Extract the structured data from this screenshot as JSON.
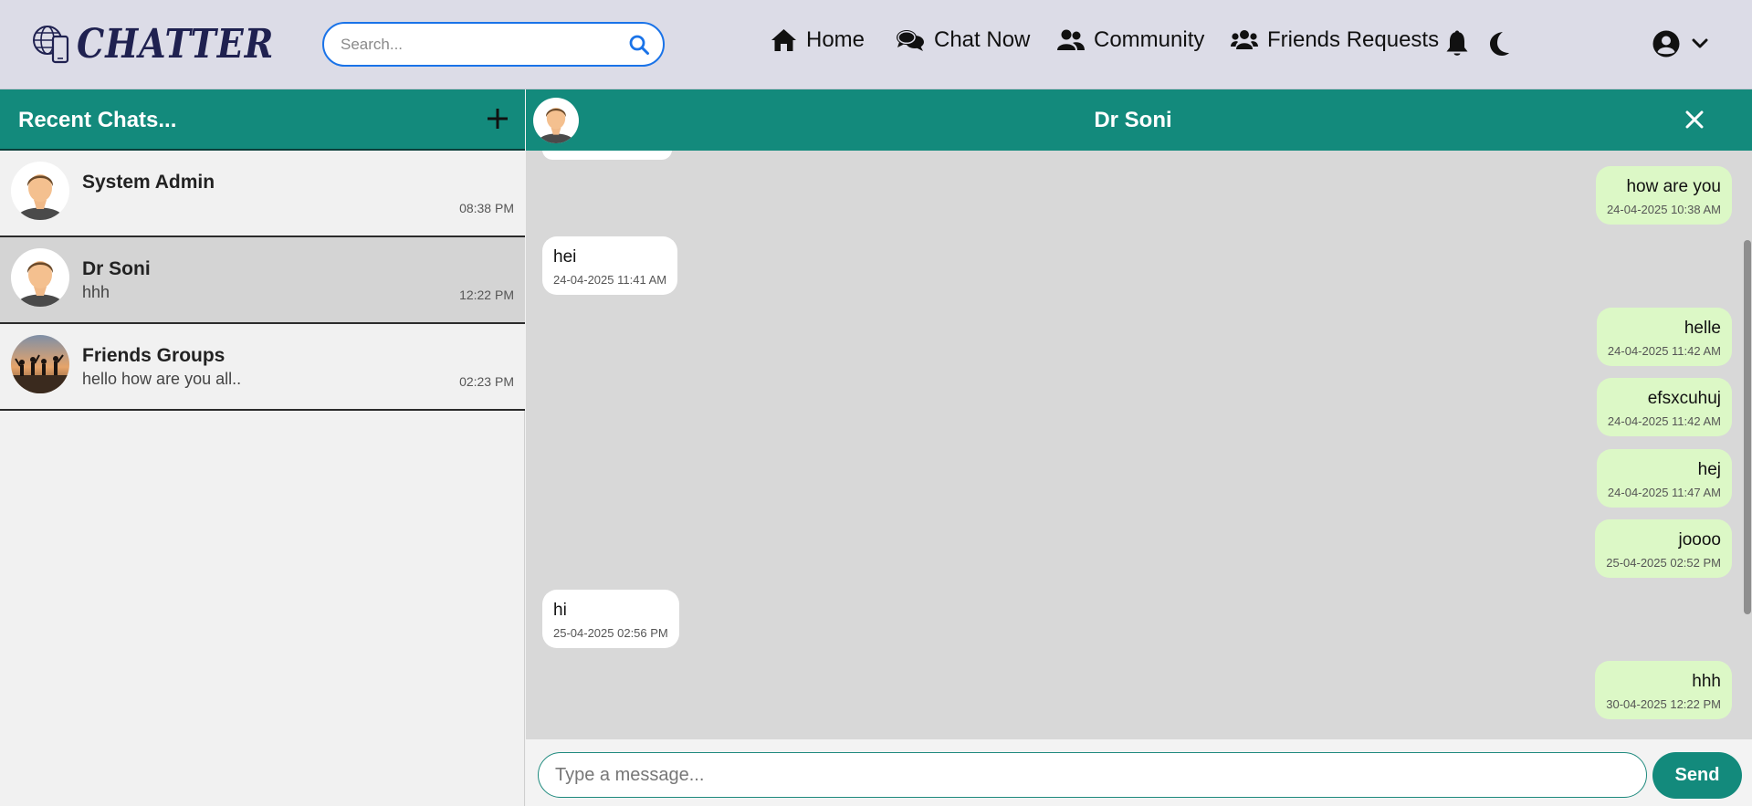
{
  "brand": {
    "name": "CHATTER"
  },
  "search": {
    "placeholder": "Search..."
  },
  "nav": {
    "home": "Home",
    "chat_now": "Chat Now",
    "community": "Community",
    "friends_requests": "Friends Requests"
  },
  "sidebar": {
    "title": "Recent Chats...",
    "chats": [
      {
        "name": "System Admin",
        "preview": "",
        "time": "08:38 PM",
        "active": false
      },
      {
        "name": "Dr Soni",
        "preview": "hhh",
        "time": "12:22 PM",
        "active": true
      },
      {
        "name": "Friends Groups",
        "preview": "hello how are you all..",
        "time": "02:23 PM",
        "active": false
      }
    ]
  },
  "conversation": {
    "title": "Dr Soni",
    "messages": [
      {
        "direction": "out",
        "text": "how are you",
        "time": "24-04-2025 10:38 AM"
      },
      {
        "direction": "in",
        "text": "hei",
        "time": "24-04-2025 11:41 AM"
      },
      {
        "direction": "out",
        "text": "helle",
        "time": "24-04-2025 11:42 AM"
      },
      {
        "direction": "out",
        "text": "efsxcuhuj",
        "time": "24-04-2025 11:42 AM"
      },
      {
        "direction": "out",
        "text": "hej",
        "time": "24-04-2025 11:47 AM"
      },
      {
        "direction": "out",
        "text": "joooo",
        "time": "25-04-2025 02:52 PM"
      },
      {
        "direction": "in",
        "text": "hi",
        "time": "25-04-2025 02:56 PM"
      },
      {
        "direction": "out",
        "text": "hhh",
        "time": "30-04-2025 12:22 PM"
      }
    ]
  },
  "composer": {
    "placeholder": "Type a message...",
    "send_label": "Send"
  },
  "colors": {
    "accent": "#138a7c",
    "topbar": "#dcdce7",
    "outgoing_bubble": "#dcf8c6",
    "incoming_bubble": "#ffffff",
    "chat_background": "#d8d8d8",
    "search_border": "#1a73e8"
  },
  "icons": {
    "logo": "globe-phone-icon",
    "search": "search-icon",
    "home": "home-icon",
    "chat_now": "chat-bubbles-icon",
    "community": "users-icon",
    "friends_requests": "user-group-icon",
    "notifications": "bell-icon",
    "theme": "moon-icon",
    "account": "user-circle-icon",
    "account_menu": "chevron-down-icon",
    "new_chat": "plus-icon",
    "close_chat": "close-icon"
  }
}
